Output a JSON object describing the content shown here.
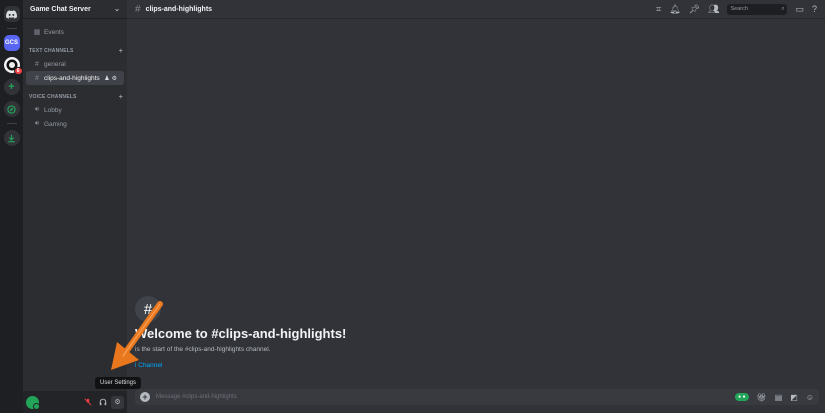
{
  "rail": {
    "gcs_label": "GCS",
    "badge_count": "6"
  },
  "server": {
    "name": "Game Chat Server"
  },
  "sidebar": {
    "events_label": "Events",
    "text_category": "TEXT CHANNELS",
    "voice_category": "VOICE CHANNELS",
    "text_channels": [
      "general",
      "clips-and-highlights"
    ],
    "voice_channels": [
      "Lobby",
      "Gaming"
    ]
  },
  "topbar": {
    "channel_name": "clips-and-highlights",
    "search_placeholder": "Search"
  },
  "welcome": {
    "title": "Welcome to #clips-and-highlights!",
    "subtitle": "is the start of the #clips-and-highlights channel.",
    "link": "l Channel"
  },
  "composer": {
    "placeholder": "Message #clips-and-highlights"
  },
  "tooltip": {
    "text": "User Settings"
  },
  "colors": {
    "accent": "#5865f2",
    "green": "#23a559",
    "arrow": "#e8771e"
  }
}
